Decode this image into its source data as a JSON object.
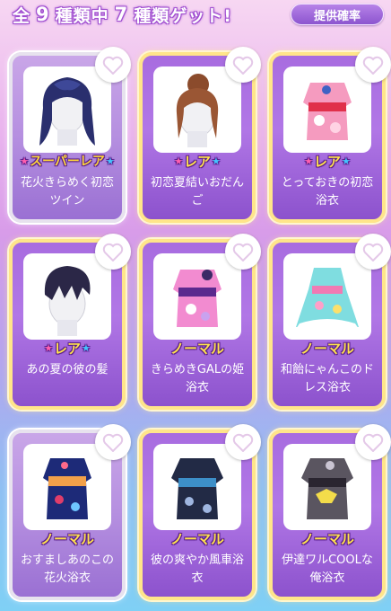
{
  "header": {
    "total_label": "全",
    "total_count": "9",
    "kinds_among": "種類中",
    "got_count": "7",
    "kinds_got": "種類ゲット!",
    "odds_button": "提供確率"
  },
  "colors": {
    "card_purple": "#a86ce0",
    "card_border_gold": "#ffe58a",
    "card_border_silver": "#e7e2ee",
    "badge_text": "#ffe34d"
  },
  "items": [
    {
      "rarity": "スーパーレア",
      "rarity_kind": "super",
      "name": "花火きらめく初恋ツイン",
      "art": "hair-twin-dark"
    },
    {
      "rarity": "レア",
      "rarity_kind": "rare",
      "name": "初恋夏結いおだんご",
      "art": "hair-bun-brown"
    },
    {
      "rarity": "レア",
      "rarity_kind": "rare",
      "name": "とっておきの初恋浴衣",
      "art": "yukata-pink-red"
    },
    {
      "rarity": "レア",
      "rarity_kind": "rare",
      "name": "あの夏の彼の髪",
      "art": "hair-boy-dark"
    },
    {
      "rarity": "ノーマル",
      "rarity_kind": "normal",
      "name": "きらめきGALの姫浴衣",
      "art": "yukata-pink-purple"
    },
    {
      "rarity": "ノーマル",
      "rarity_kind": "normal",
      "name": "和飴にゃんこのドレス浴衣",
      "art": "yukata-teal-dress"
    },
    {
      "rarity": "ノーマル",
      "rarity_kind": "normal",
      "name": "おすましあのこの花火浴衣",
      "art": "yukata-navy-orange"
    },
    {
      "rarity": "ノーマル",
      "rarity_kind": "normal",
      "name": "彼の爽やか風車浴衣",
      "art": "yukata-navy-blue"
    },
    {
      "rarity": "ノーマル",
      "rarity_kind": "normal",
      "name": "伊達ワルCOOLな俺浴衣",
      "art": "yukata-gray-yellow"
    }
  ]
}
